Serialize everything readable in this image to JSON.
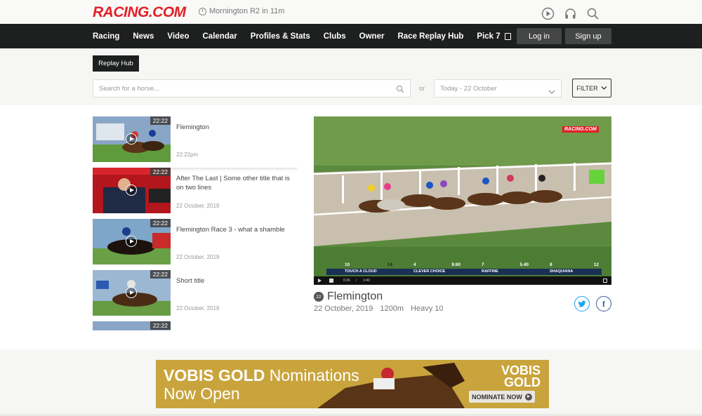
{
  "brand": {
    "logo": "RACING.COM",
    "accent": "#e41e26"
  },
  "header": {
    "next_race": "Mornington R2 in 11m",
    "icons": [
      "play-circle-icon",
      "headphones-icon",
      "search-icon"
    ]
  },
  "nav": {
    "items": [
      "Racing",
      "News",
      "Video",
      "Calendar",
      "Profiles & Stats",
      "Clubs",
      "Owner",
      "Race Replay Hub",
      "Pick 7"
    ],
    "login": "Log in",
    "signup": "Sign up"
  },
  "hub": {
    "tab": "Replay Hub",
    "search_placeholder": "Search for a horse...",
    "or": "or",
    "date_value": "Today - 22 October",
    "filter": "FILTER"
  },
  "replays": [
    {
      "duration": "22:22",
      "title": "Flemington",
      "date": "22:22pm",
      "active": true
    },
    {
      "duration": "22:22",
      "title": "After The Last | Some other title that is on two lines",
      "date": "22 October, 2019"
    },
    {
      "duration": "22:22",
      "title": "Flemington Race 3 - what a shamble",
      "date": "22 October, 2019"
    },
    {
      "duration": "22:22",
      "title": "Short title",
      "date": "22 October, 2019"
    },
    {
      "duration": "22:22",
      "title": "",
      "date": ""
    }
  ],
  "player": {
    "logo": "RACING.COM",
    "time": "0:36",
    "total": "1:40",
    "runners": [
      {
        "num": "10",
        "name": "TOUCH A CLOUD",
        "odds": "14"
      },
      {
        "num": "4",
        "name": "CLEVER CHOICE",
        "odds": "9.60"
      },
      {
        "num": "7",
        "name": "RAFFINE",
        "odds": "5.40"
      },
      {
        "num": "8",
        "name": "SHAQUIANA",
        "odds": "12"
      }
    ]
  },
  "race": {
    "number": "22",
    "venue": "Flemington",
    "date": "22 October, 2019",
    "distance": "1200m",
    "track": "Heavy 10"
  },
  "ad": {
    "line1_bold": "VOBIS GOLD",
    "line1_rest": " Nominations",
    "line2": "Now Open",
    "brand": "VOBIS GOLD",
    "cta": "NOMINATE NOW"
  }
}
